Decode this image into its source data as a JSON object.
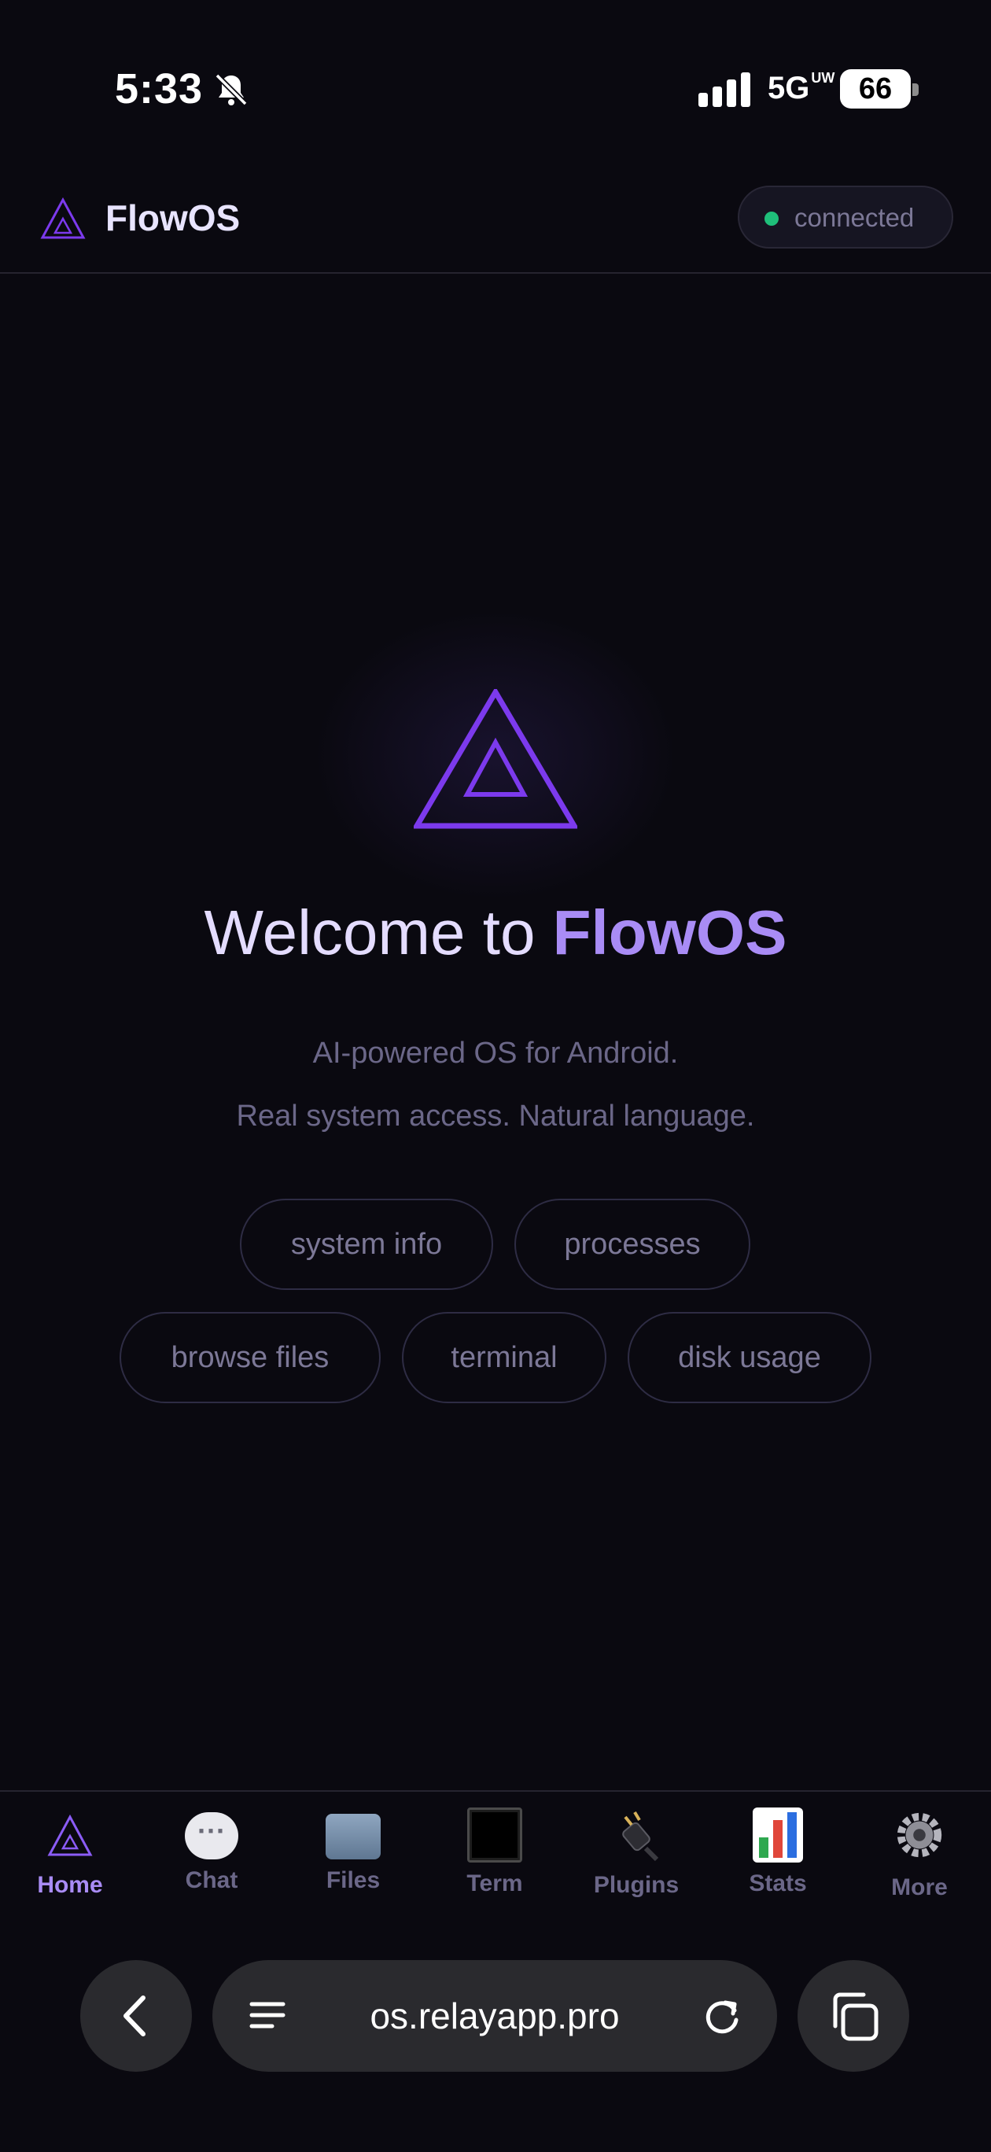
{
  "status_bar": {
    "time": "5:33",
    "network": "5G",
    "network_sub": "UW",
    "battery": "66"
  },
  "header": {
    "title": "FlowOS",
    "status": "connected",
    "status_color": "#1fbf7a"
  },
  "hero": {
    "welcome_prefix": "Welcome to ",
    "welcome_brand": "FlowOS",
    "subtitle_line1": "AI-powered OS for Android.",
    "subtitle_line2": "Real system access. Natural language."
  },
  "chips": [
    "system info",
    "processes",
    "browse files",
    "terminal",
    "disk usage"
  ],
  "nav": {
    "items": [
      {
        "label": "Home",
        "icon": "triangle-logo-icon"
      },
      {
        "label": "Chat",
        "icon": "speech-bubble-icon"
      },
      {
        "label": "Files",
        "icon": "folder-icon"
      },
      {
        "label": "Term",
        "icon": "terminal-icon"
      },
      {
        "label": "Plugins",
        "icon": "plug-icon"
      },
      {
        "label": "Stats",
        "icon": "bar-chart-icon"
      },
      {
        "label": "More",
        "icon": "gear-icon"
      }
    ],
    "active": "Home"
  },
  "browser": {
    "url": "os.relayapp.pro"
  },
  "colors": {
    "accent": "#a98cf5",
    "logo_stroke": "#7c3aed",
    "background": "#0a0910"
  }
}
